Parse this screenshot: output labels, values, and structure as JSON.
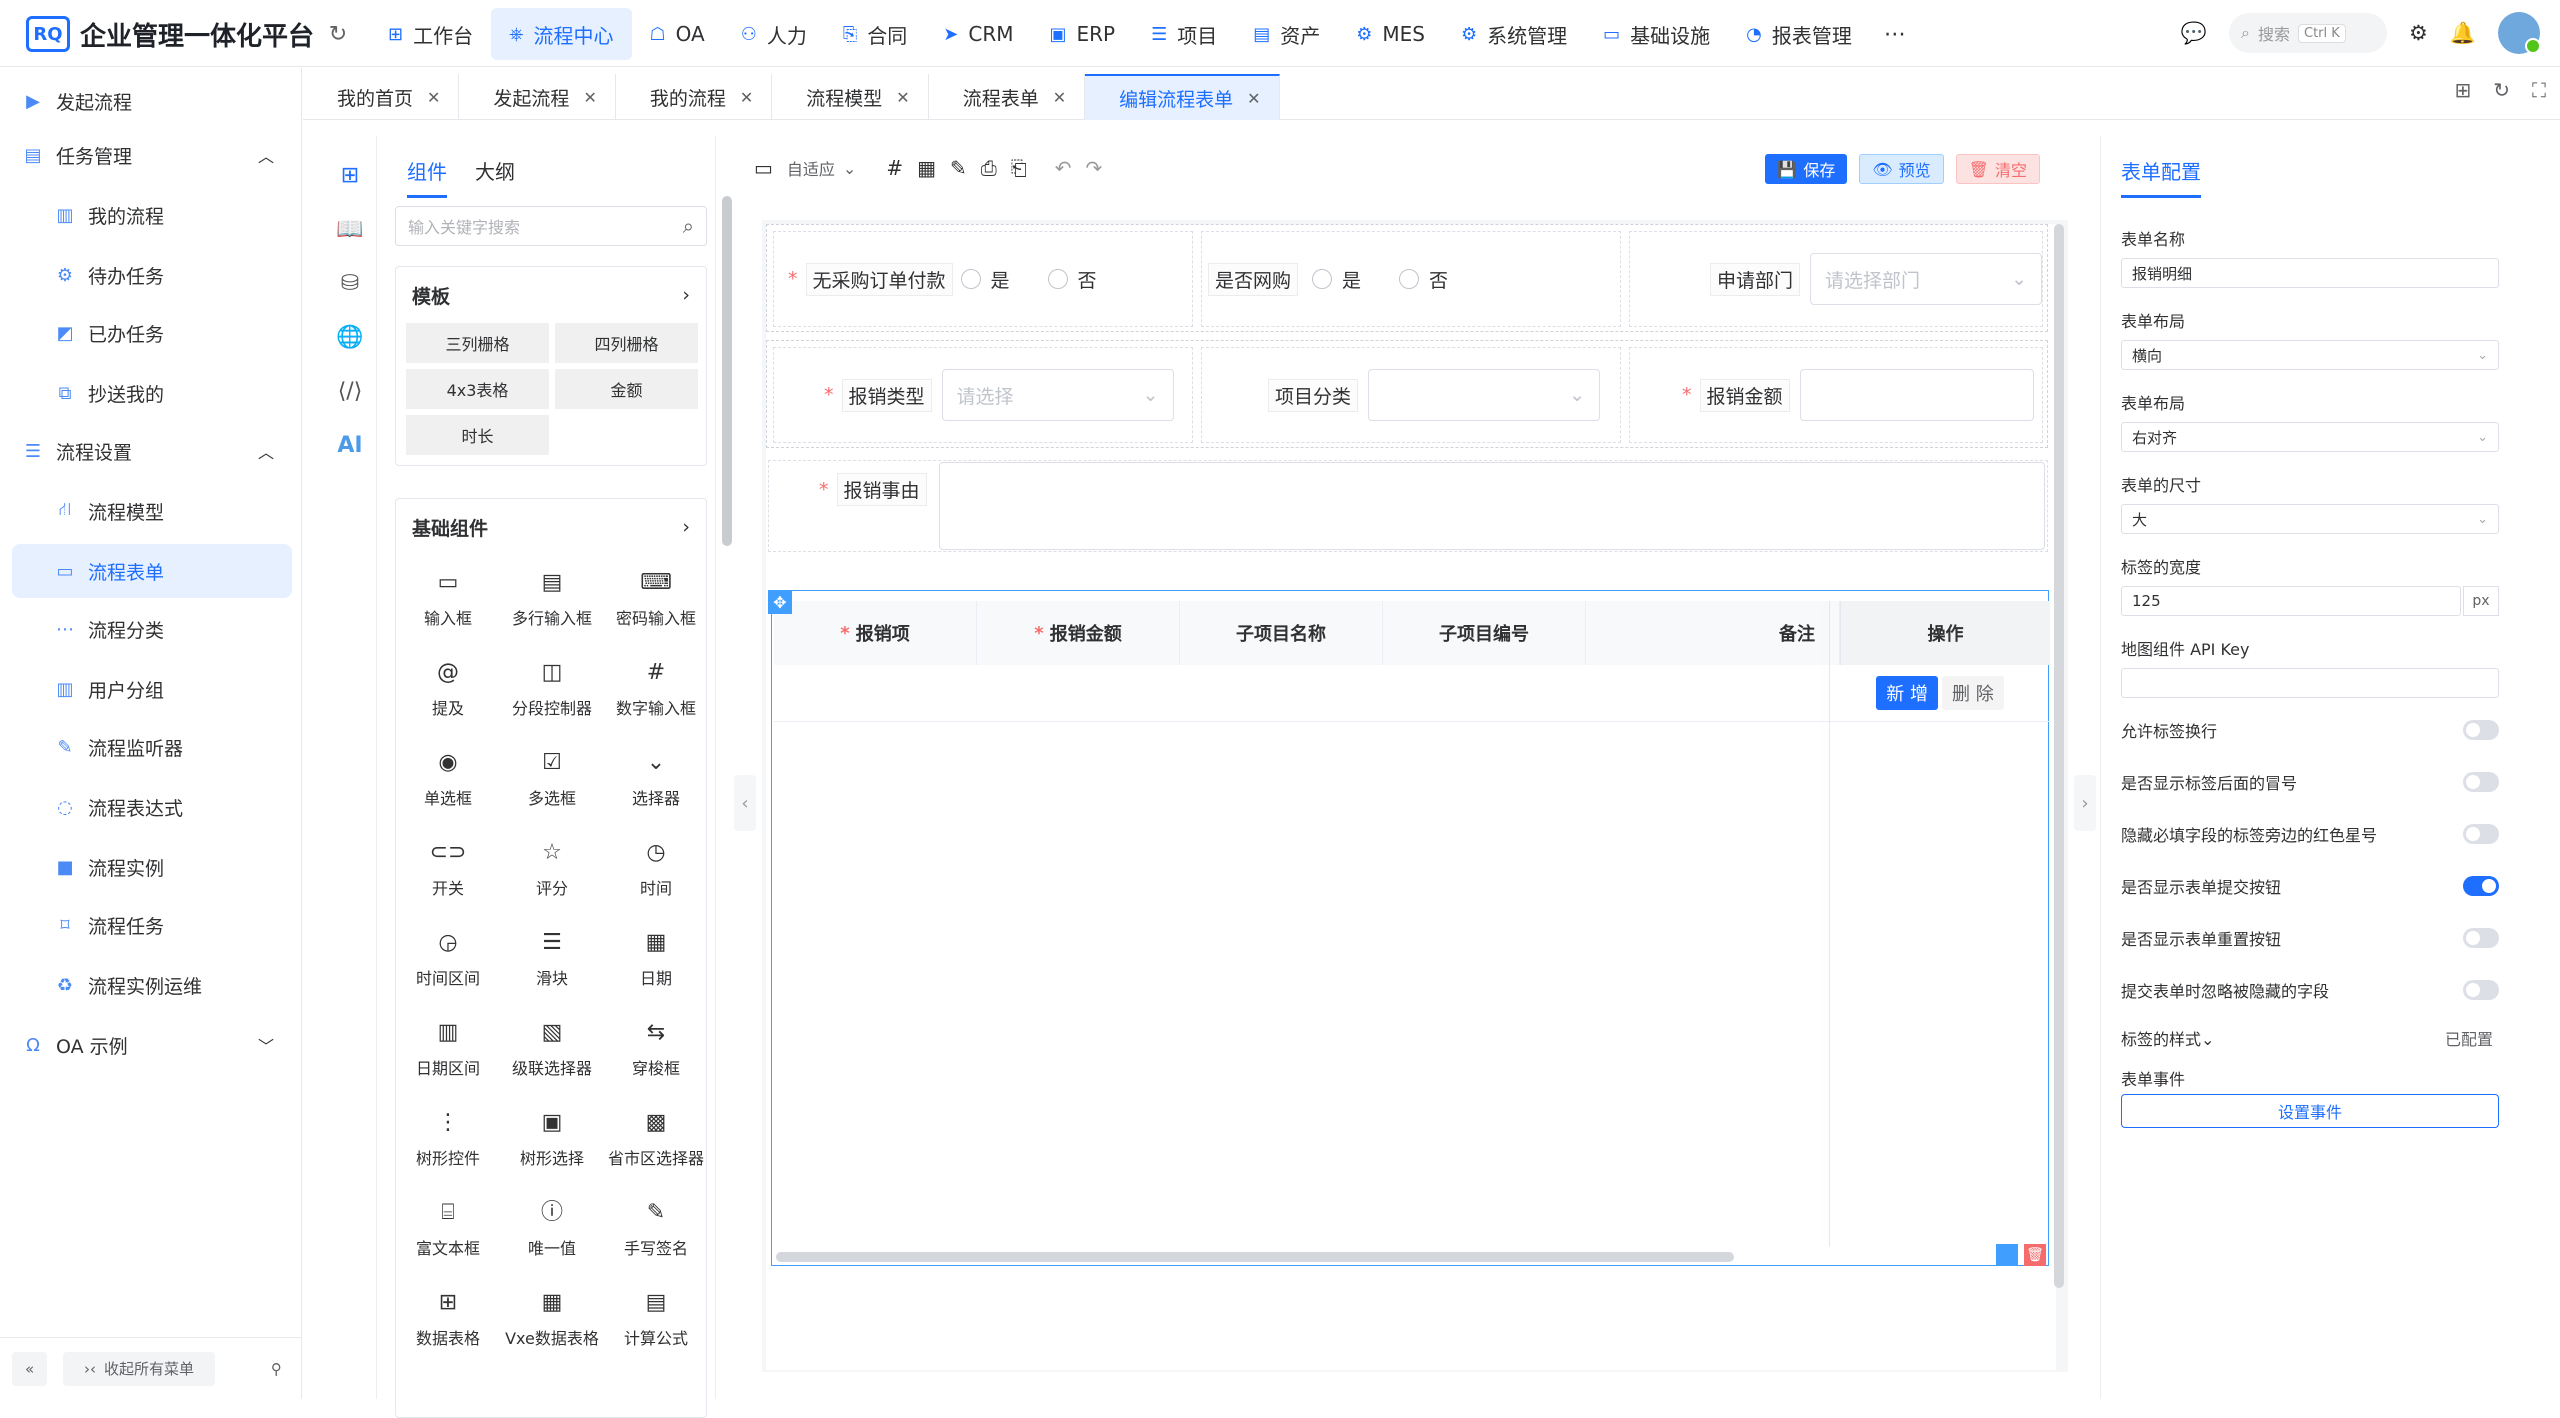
{
  "app": {
    "logo": "RQ",
    "title": "企业管理一体化平台"
  },
  "topnav": [
    {
      "label": "工作台",
      "icon": "grid-icon"
    },
    {
      "label": "流程中心",
      "icon": "workflow-icon",
      "active": true
    },
    {
      "label": "OA",
      "icon": "oa-icon"
    },
    {
      "label": "人力",
      "icon": "user-icon"
    },
    {
      "label": "合同",
      "icon": "contract-icon"
    },
    {
      "label": "CRM",
      "icon": "crm-icon"
    },
    {
      "label": "ERP",
      "icon": "erp-icon"
    },
    {
      "label": "项目",
      "icon": "project-icon"
    },
    {
      "label": "资产",
      "icon": "asset-icon"
    },
    {
      "label": "MES",
      "icon": "mes-icon"
    },
    {
      "label": "系统管理",
      "icon": "gear-icon"
    },
    {
      "label": "基础设施",
      "icon": "monitor-icon"
    },
    {
      "label": "报表管理",
      "icon": "report-icon"
    }
  ],
  "search": {
    "placeholder": "搜索",
    "shortcut": "Ctrl K"
  },
  "sidebar": {
    "items": [
      {
        "label": "发起流程",
        "level": 1,
        "icon": "play-icon"
      },
      {
        "label": "任务管理",
        "level": 1,
        "icon": "task-icon",
        "expanded": true
      },
      {
        "label": "我的流程",
        "level": 2,
        "icon": "doc-icon"
      },
      {
        "label": "待办任务",
        "level": 2,
        "icon": "gear-icon"
      },
      {
        "label": "已办任务",
        "level": 2,
        "icon": "done-icon"
      },
      {
        "label": "抄送我的",
        "level": 2,
        "icon": "copy-icon"
      },
      {
        "label": "流程设置",
        "level": 1,
        "icon": "list-icon",
        "expanded": true
      },
      {
        "label": "流程模型",
        "level": 2,
        "icon": "model-icon"
      },
      {
        "label": "流程表单",
        "level": 2,
        "icon": "form-icon",
        "active": true
      },
      {
        "label": "流程分类",
        "level": 2,
        "icon": "category-icon"
      },
      {
        "label": "用户分组",
        "level": 2,
        "icon": "group-icon"
      },
      {
        "label": "流程监听器",
        "level": 2,
        "icon": "listener-icon"
      },
      {
        "label": "流程表达式",
        "level": 2,
        "icon": "expression-icon"
      },
      {
        "label": "流程实例",
        "level": 2,
        "icon": "instance-icon"
      },
      {
        "label": "流程任务",
        "level": 2,
        "icon": "bookmark-icon"
      },
      {
        "label": "流程实例运维",
        "level": 2,
        "icon": "recycle-icon"
      },
      {
        "label": "OA 示例",
        "level": 1,
        "icon": "oa-icon",
        "expanded": false
      }
    ],
    "footer": {
      "collapse_all": "收起所有菜单"
    }
  },
  "tabs": [
    {
      "label": "我的首页"
    },
    {
      "label": "发起流程"
    },
    {
      "label": "我的流程"
    },
    {
      "label": "流程模型"
    },
    {
      "label": "流程表单"
    },
    {
      "label": "编辑流程表单",
      "active": true
    }
  ],
  "component_panel": {
    "tabs": [
      "组件",
      "大纲"
    ],
    "search_placeholder": "输入关键字搜索",
    "template_title": "模板",
    "templates": [
      "三列栅格",
      "四列栅格",
      "4x3表格",
      "金额",
      "时长"
    ],
    "basic_title": "基础组件",
    "basic": [
      {
        "label": "输入框",
        "icon": "input-icon",
        "glyph": "▭"
      },
      {
        "label": "多行输入框",
        "icon": "textarea-icon",
        "glyph": "▤"
      },
      {
        "label": "密码输入框",
        "icon": "password-icon",
        "glyph": "⌨"
      },
      {
        "label": "提及",
        "icon": "mention-icon",
        "glyph": "@"
      },
      {
        "label": "分段控制器",
        "icon": "segmented-icon",
        "glyph": "◫"
      },
      {
        "label": "数字输入框",
        "icon": "number-icon",
        "glyph": "#"
      },
      {
        "label": "单选框",
        "icon": "radio-icon",
        "glyph": "◉"
      },
      {
        "label": "多选框",
        "icon": "checkbox-icon",
        "glyph": "☑"
      },
      {
        "label": "选择器",
        "icon": "select-icon",
        "glyph": "⌄"
      },
      {
        "label": "开关",
        "icon": "switch-icon",
        "glyph": "⊂⊃"
      },
      {
        "label": "评分",
        "icon": "star-icon",
        "glyph": "☆"
      },
      {
        "label": "时间",
        "icon": "clock-icon",
        "glyph": "◷"
      },
      {
        "label": "时间区间",
        "icon": "time-range-icon",
        "glyph": "◶"
      },
      {
        "label": "滑块",
        "icon": "slider-icon",
        "glyph": "☰"
      },
      {
        "label": "日期",
        "icon": "calendar-icon",
        "glyph": "▦"
      },
      {
        "label": "日期区间",
        "icon": "date-range-icon",
        "glyph": "▥"
      },
      {
        "label": "级联选择器",
        "icon": "cascader-icon",
        "glyph": "▧"
      },
      {
        "label": "穿梭框",
        "icon": "transfer-icon",
        "glyph": "⇆"
      },
      {
        "label": "树形控件",
        "icon": "tree-icon",
        "glyph": "⋮"
      },
      {
        "label": "树形选择",
        "icon": "tree-select-icon",
        "glyph": "▣"
      },
      {
        "label": "省市区选择器",
        "icon": "region-icon",
        "glyph": "▩"
      },
      {
        "label": "富文本框",
        "icon": "richtext-icon",
        "glyph": "⌸"
      },
      {
        "label": "唯一值",
        "icon": "id-icon",
        "glyph": "ⓘ"
      },
      {
        "label": "手写签名",
        "icon": "signature-icon",
        "glyph": "✎"
      },
      {
        "label": "数据表格",
        "icon": "table-icon",
        "glyph": "⊞"
      },
      {
        "label": "Vxe数据表格",
        "icon": "vxe-table-icon",
        "glyph": "▦"
      },
      {
        "label": "计算公式",
        "icon": "formula-icon",
        "glyph": "▤"
      }
    ]
  },
  "toolbar": {
    "device": "自适应",
    "save": "保存",
    "preview": "预览",
    "clear": "清空"
  },
  "form": {
    "row1": [
      {
        "label": "无采购订单付款",
        "required": true,
        "type": "radio",
        "options": [
          "是",
          "否"
        ]
      },
      {
        "label": "是否网购",
        "required": false,
        "type": "radio",
        "options": [
          "是",
          "否"
        ]
      },
      {
        "label": "申请部门",
        "required": false,
        "type": "select",
        "placeholder": "请选择部门"
      }
    ],
    "row2": [
      {
        "label": "报销类型",
        "required": true,
        "type": "select",
        "placeholder": "请选择"
      },
      {
        "label": "项目分类",
        "required": false,
        "type": "select",
        "placeholder": ""
      },
      {
        "label": "报销金额",
        "required": true,
        "type": "input"
      }
    ],
    "row3": {
      "label": "报销事由",
      "required": true,
      "type": "textarea"
    },
    "subtable": {
      "columns": [
        {
          "label": "报销项",
          "required": true
        },
        {
          "label": "报销金额",
          "required": true
        },
        {
          "label": "子项目名称",
          "required": false
        },
        {
          "label": "子项目编号",
          "required": false
        },
        {
          "label": "备注",
          "required": false
        }
      ],
      "op_column": "操作",
      "add": "新 增",
      "delete": "删 除"
    }
  },
  "config": {
    "title": "表单配置",
    "form_name_label": "表单名称",
    "form_name": "报销明细",
    "layout_label": "表单布局",
    "layout": "横向",
    "align_label": "表单布局",
    "align": "右对齐",
    "size_label": "表单的尺寸",
    "size": "大",
    "label_width_label": "标签的宽度",
    "label_width": "125",
    "label_width_unit": "px",
    "map_key_label": "地图组件 API Key",
    "map_key": "",
    "toggles": [
      {
        "label": "允许标签换行",
        "on": false
      },
      {
        "label": "是否显示标签后面的冒号",
        "on": false
      },
      {
        "label": "隐藏必填字段的标签旁边的红色星号",
        "on": false
      },
      {
        "label": "是否显示表单提交按钮",
        "on": true
      },
      {
        "label": "是否显示表单重置按钮",
        "on": false
      },
      {
        "label": "提交表单时忽略被隐藏的字段",
        "on": false
      }
    ],
    "label_style_label": "标签的样式",
    "label_style_value": "已配置",
    "event_label": "表单事件",
    "event_button": "设置事件"
  },
  "colors": {
    "primary": "#1e6fff",
    "danger": "#f56c6c"
  }
}
